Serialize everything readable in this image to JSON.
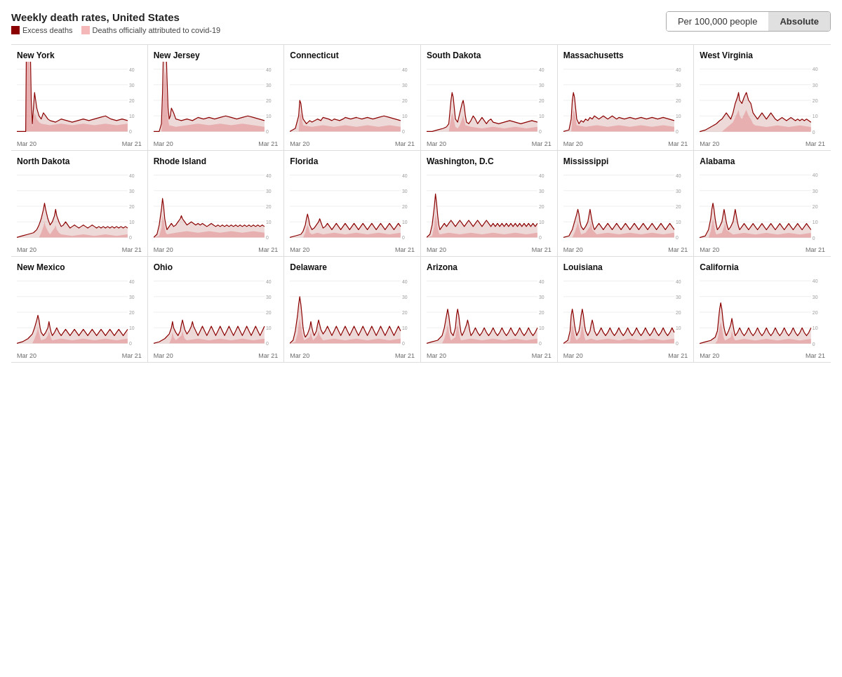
{
  "header": {
    "title": "Weekly death rates, United States",
    "legend": {
      "excess": "Excess deaths",
      "covid": "Deaths officially attributed to covid-19"
    },
    "toggle": {
      "per100k": "Per 100,000 people",
      "absolute": "Absolute",
      "active": "per100k"
    }
  },
  "y_labels": [
    "40",
    "30",
    "20",
    "10",
    "0"
  ],
  "x_labels": [
    "Mar 20",
    "Mar 21"
  ],
  "charts": [
    {
      "name": "New York",
      "row": 0
    },
    {
      "name": "New Jersey",
      "row": 0
    },
    {
      "name": "Connecticut",
      "row": 0
    },
    {
      "name": "South Dakota",
      "row": 0
    },
    {
      "name": "Massachusetts",
      "row": 0
    },
    {
      "name": "West Virginia",
      "row": 0
    },
    {
      "name": "North Dakota",
      "row": 1
    },
    {
      "name": "Rhode Island",
      "row": 1
    },
    {
      "name": "Florida",
      "row": 1
    },
    {
      "name": "Washington, D.C",
      "row": 1
    },
    {
      "name": "Mississippi",
      "row": 1
    },
    {
      "name": "Alabama",
      "row": 1
    },
    {
      "name": "New Mexico",
      "row": 2
    },
    {
      "name": "Ohio",
      "row": 2
    },
    {
      "name": "Delaware",
      "row": 2
    },
    {
      "name": "Arizona",
      "row": 2
    },
    {
      "name": "Louisiana",
      "row": 2
    },
    {
      "name": "California",
      "row": 2
    }
  ]
}
